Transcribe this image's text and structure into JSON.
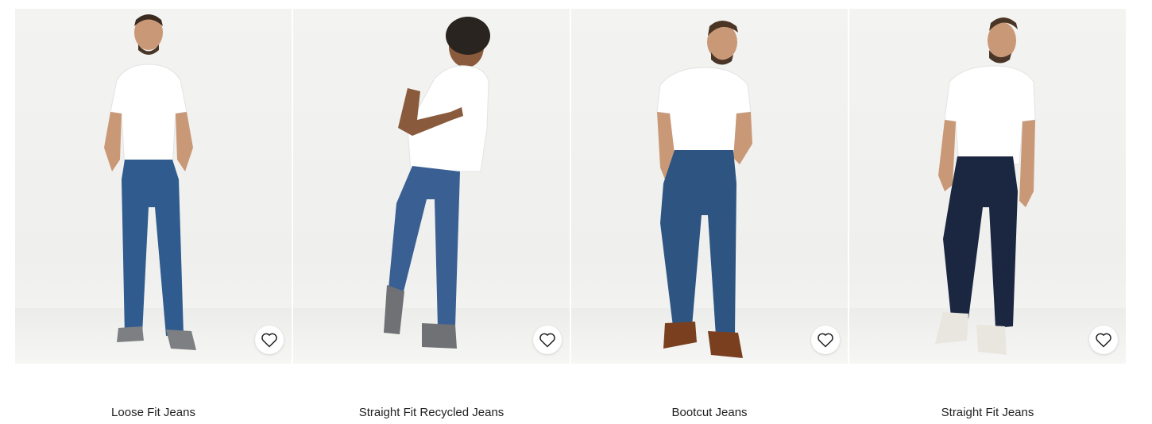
{
  "products": [
    {
      "name": "Loose Fit Jeans",
      "wishlist_icon": "heart-icon",
      "jean_color": "#2f5b8e",
      "shoe_color": "#7d7f82"
    },
    {
      "name": "Straight Fit Recycled Jeans",
      "wishlist_icon": "heart-icon",
      "jean_color": "#3a5f92",
      "shoe_color": "#6f7174"
    },
    {
      "name": "Bootcut Jeans",
      "wishlist_icon": "heart-icon",
      "jean_color": "#2e5582",
      "shoe_color": "#7a3f1f"
    },
    {
      "name": "Straight Fit Jeans",
      "wishlist_icon": "heart-icon",
      "jean_color": "#1b2640",
      "shoe_color": "#e9e6df"
    }
  ]
}
